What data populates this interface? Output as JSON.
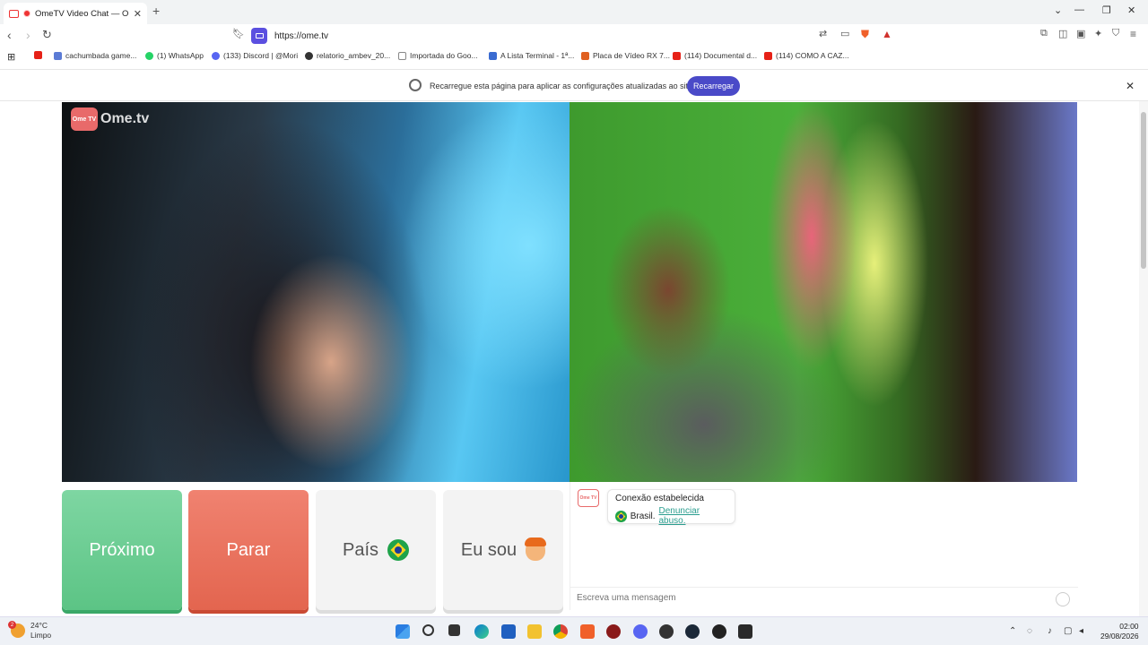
{
  "browser": {
    "tab_title": "OmeTV Video Chat — Omeg",
    "tab_close": "✕",
    "new_tab": "+",
    "url": "https://ome.tv",
    "window_controls": {
      "minimize": "—",
      "maximize": "❐",
      "close": "✕",
      "tabs_menu": "⌄"
    }
  },
  "bookmarks": [
    {
      "label": "",
      "icon": "youtube-icon",
      "color": "#e62117"
    },
    {
      "label": "cachumbada game...",
      "icon": "bookmark-site-icon",
      "color": "#5b7bd5"
    },
    {
      "label": "(1) WhatsApp",
      "icon": "whatsapp-icon",
      "color": "#25d366"
    },
    {
      "label": "(133) Discord | @Mori",
      "icon": "discord-icon",
      "color": "#5865f2"
    },
    {
      "label": "relatorio_ambev_20...",
      "icon": "github-icon",
      "color": "#333333"
    },
    {
      "label": "Importada do Goo...",
      "icon": "folder-icon",
      "color": "#888888"
    },
    {
      "label": "A Lista Terminal - 1ª...",
      "icon": "site-icon",
      "color": "#3a6bd1"
    },
    {
      "label": "Placa de Vídeo RX 7...",
      "icon": "store-icon",
      "color": "#e06020"
    },
    {
      "label": "(114) Documental d...",
      "icon": "youtube-icon",
      "color": "#e62117"
    },
    {
      "label": "(114) COMO A CAZ...",
      "icon": "youtube-icon",
      "color": "#e62117"
    }
  ],
  "infobar": {
    "message": "Recarregue esta página para aplicar as configurações atualizadas ao site.",
    "reload_label": "Recarregar",
    "close": "✕"
  },
  "ometv": {
    "logo_badge": "Ome TV",
    "logo_text": "Ome.tv",
    "buttons": {
      "next": "Próximo",
      "stop": "Parar",
      "country": "País",
      "i_am": "Eu sou"
    },
    "chat": {
      "logo_badge": "Ome TV",
      "status": "Conexão estabelecida",
      "country": "Brasil.",
      "report_link": "Denunciar abuso.",
      "input_placeholder": "Escreva uma mensagem"
    }
  },
  "taskbar": {
    "weather_temp": "24°C",
    "weather_desc": "Limpo",
    "weather_badge": "2",
    "time": "02:00",
    "date": "29/08/2026"
  }
}
